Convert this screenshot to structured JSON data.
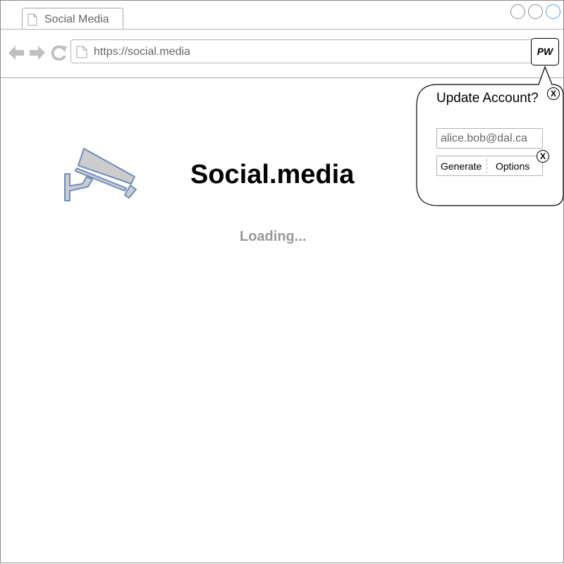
{
  "browser": {
    "tab_title": "Social Media",
    "url": "https://social.media"
  },
  "extension": {
    "button_label": "PW"
  },
  "page": {
    "title": "Social.media",
    "status": "Loading..."
  },
  "popup": {
    "title": "Update Account?",
    "email_value": "alice.bob@dal.ca",
    "generate_label": "Generate",
    "options_label": "Options",
    "close_label": "X",
    "clear_label": "X"
  },
  "colors": {
    "accent_window_button": "#4da3e8",
    "logo_fill": "#cccccc",
    "logo_stroke": "#6c8ebf"
  }
}
